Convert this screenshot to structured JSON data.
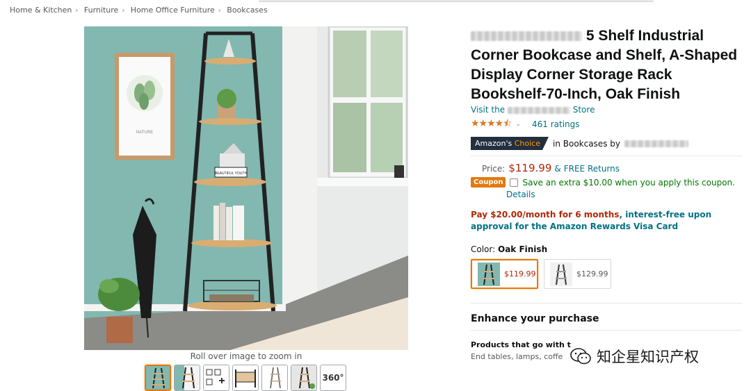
{
  "breadcrumb": [
    "Home & Kitchen",
    "Furniture",
    "Home Office Furniture",
    "Bookcases"
  ],
  "gallery": {
    "zoom_hint": "Roll over image to zoom in",
    "thumb_360_label": "360°",
    "image_text": {
      "poster": "NATURE",
      "book": "BEAUTIFUL YOUTH"
    }
  },
  "product": {
    "title": "5 Shelf Industrial Corner Bookcase and Shelf, A-Shaped Display Corner Storage Rack Bookshelf-70-Inch, Oak Finish",
    "store_prefix": "Visit the",
    "store_suffix": "Store",
    "stars": "★★★★⯪",
    "ratings": "461 ratings",
    "badge_amazon": "Amazon's",
    "badge_choice": "Choice",
    "badge_category": "in Bookcases by"
  },
  "pricing": {
    "label": "Price:",
    "price": "$119.99",
    "amp": "&",
    "free_returns": "FREE Returns",
    "coupon_badge": "Coupon",
    "coupon_text": "Save an extra $10.00 when you apply this coupon.",
    "details": "Details",
    "pay_red": "Pay $20.00/month for 6 months",
    "pay_rest": ", interest-free upon approval for the Amazon Rewards Visa Card"
  },
  "color": {
    "label": "Color:",
    "selected": "Oak Finish",
    "options": [
      {
        "price": "$119.99"
      },
      {
        "price": "$129.99"
      }
    ]
  },
  "enhance": {
    "heading": "Enhance your purchase",
    "products_title": "Products that go with t",
    "products_sub": "End tables, lamps, coffe"
  },
  "watermark": "知企星知识产权",
  "colors": {
    "link": "#007185",
    "price": "#b12704",
    "coupon_green": "#007600",
    "accent_orange": "#e77600",
    "star": "#de7921",
    "wall": "#7fb5ad"
  }
}
